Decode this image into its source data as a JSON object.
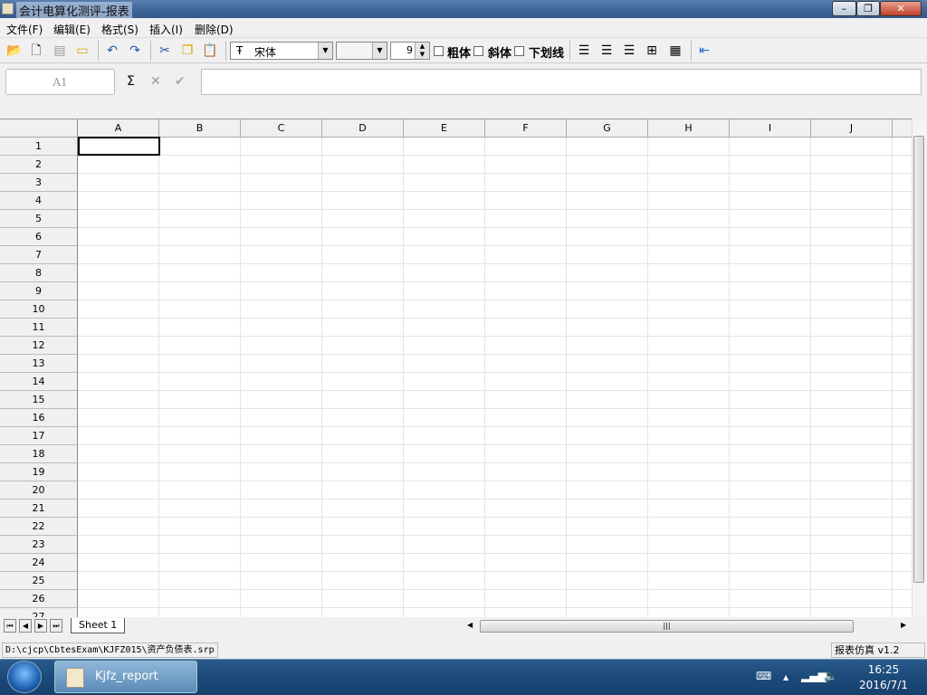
{
  "window": {
    "title": "会计电算化测评-报表",
    "min": "–",
    "max": "❐",
    "close": "✕"
  },
  "menu": [
    "文件(F)",
    "编辑(E)",
    "格式(S)",
    "插入(I)",
    "删除(D)"
  ],
  "toolbar": {
    "font_name": "宋体",
    "font_size": "9",
    "bold": "粗体",
    "italic": "斜体",
    "underline": "下划线"
  },
  "formula_bar": {
    "cell_ref": "A1",
    "sum": "Σ",
    "cancel": "✕",
    "accept": "✔",
    "value": ""
  },
  "columns": [
    "A",
    "B",
    "C",
    "D",
    "E",
    "F",
    "G",
    "H",
    "I",
    "J"
  ],
  "rows": [
    "1",
    "2",
    "3",
    "4",
    "5",
    "6",
    "7",
    "8",
    "9",
    "10",
    "11",
    "12",
    "13",
    "14",
    "15",
    "16",
    "17",
    "18",
    "19",
    "20",
    "21",
    "22",
    "23",
    "24",
    "25",
    "26",
    "27"
  ],
  "sheet_tab": "Sheet 1",
  "status": {
    "path": "D:\\cjcp\\CbtesExam\\KJFZ015\\资产负债表.srp",
    "version": "报表仿真 v1.2"
  },
  "taskbar": {
    "app": "Kjfz_report",
    "time": "16:25",
    "date": "2016/7/1"
  }
}
